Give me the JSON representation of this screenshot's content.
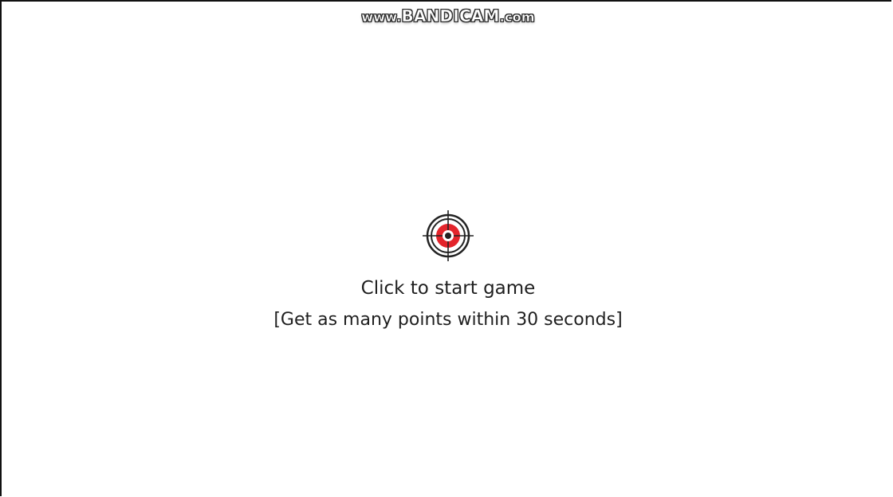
{
  "watermark": {
    "prefix": "www.",
    "brand": "BANDICAM",
    "suffix": ".com"
  },
  "game": {
    "start_label": "Click to start game",
    "start_hint": "[Get as many points within 30 seconds]",
    "icon": "crosshair-target-icon",
    "colors": {
      "target_red": "#e3242b",
      "rings": "#222222",
      "background": "#ffffff"
    }
  }
}
